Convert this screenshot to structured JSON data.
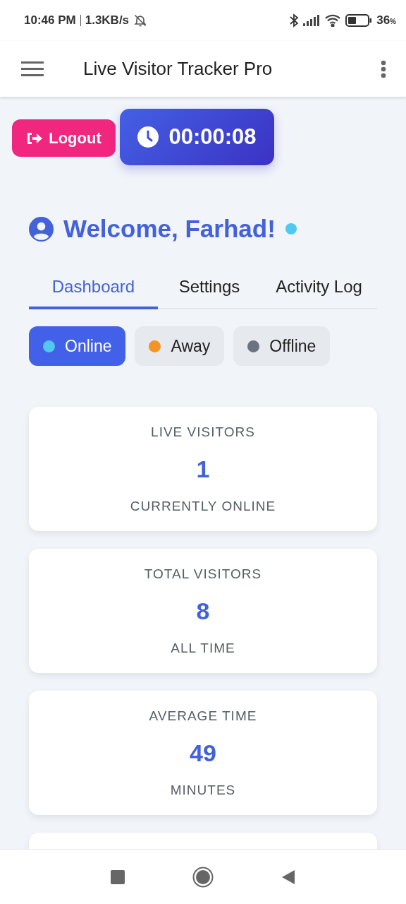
{
  "status_bar": {
    "time": "10:46 PM",
    "speed": "1.3KB/s",
    "battery": "36",
    "battery_unit": "%"
  },
  "app_bar": {
    "title": "Live Visitor Tracker Pro"
  },
  "logout_button": {
    "label": "Logout"
  },
  "timer": {
    "value": "00:00:08"
  },
  "welcome": {
    "text": "Welcome, Farhad!",
    "color": "#4fc9ef"
  },
  "tabs": [
    {
      "label": "Dashboard",
      "selected": true
    },
    {
      "label": "Settings",
      "selected": false
    },
    {
      "label": "Activity Log",
      "selected": false
    }
  ],
  "presence_options": [
    {
      "label": "Online",
      "color": "#4fc9ef",
      "selected": true
    },
    {
      "label": "Away",
      "color": "#f39424",
      "selected": false
    },
    {
      "label": "Offline",
      "color": "#6b7280",
      "selected": false
    }
  ],
  "stats": [
    {
      "title": "LIVE VISITORS",
      "value": "1",
      "caption": "CURRENTLY ONLINE"
    },
    {
      "title": "TOTAL VISITORS",
      "value": "8",
      "caption": "ALL TIME"
    },
    {
      "title": "AVERAGE TIME",
      "value": "49",
      "caption": "MINUTES"
    }
  ]
}
